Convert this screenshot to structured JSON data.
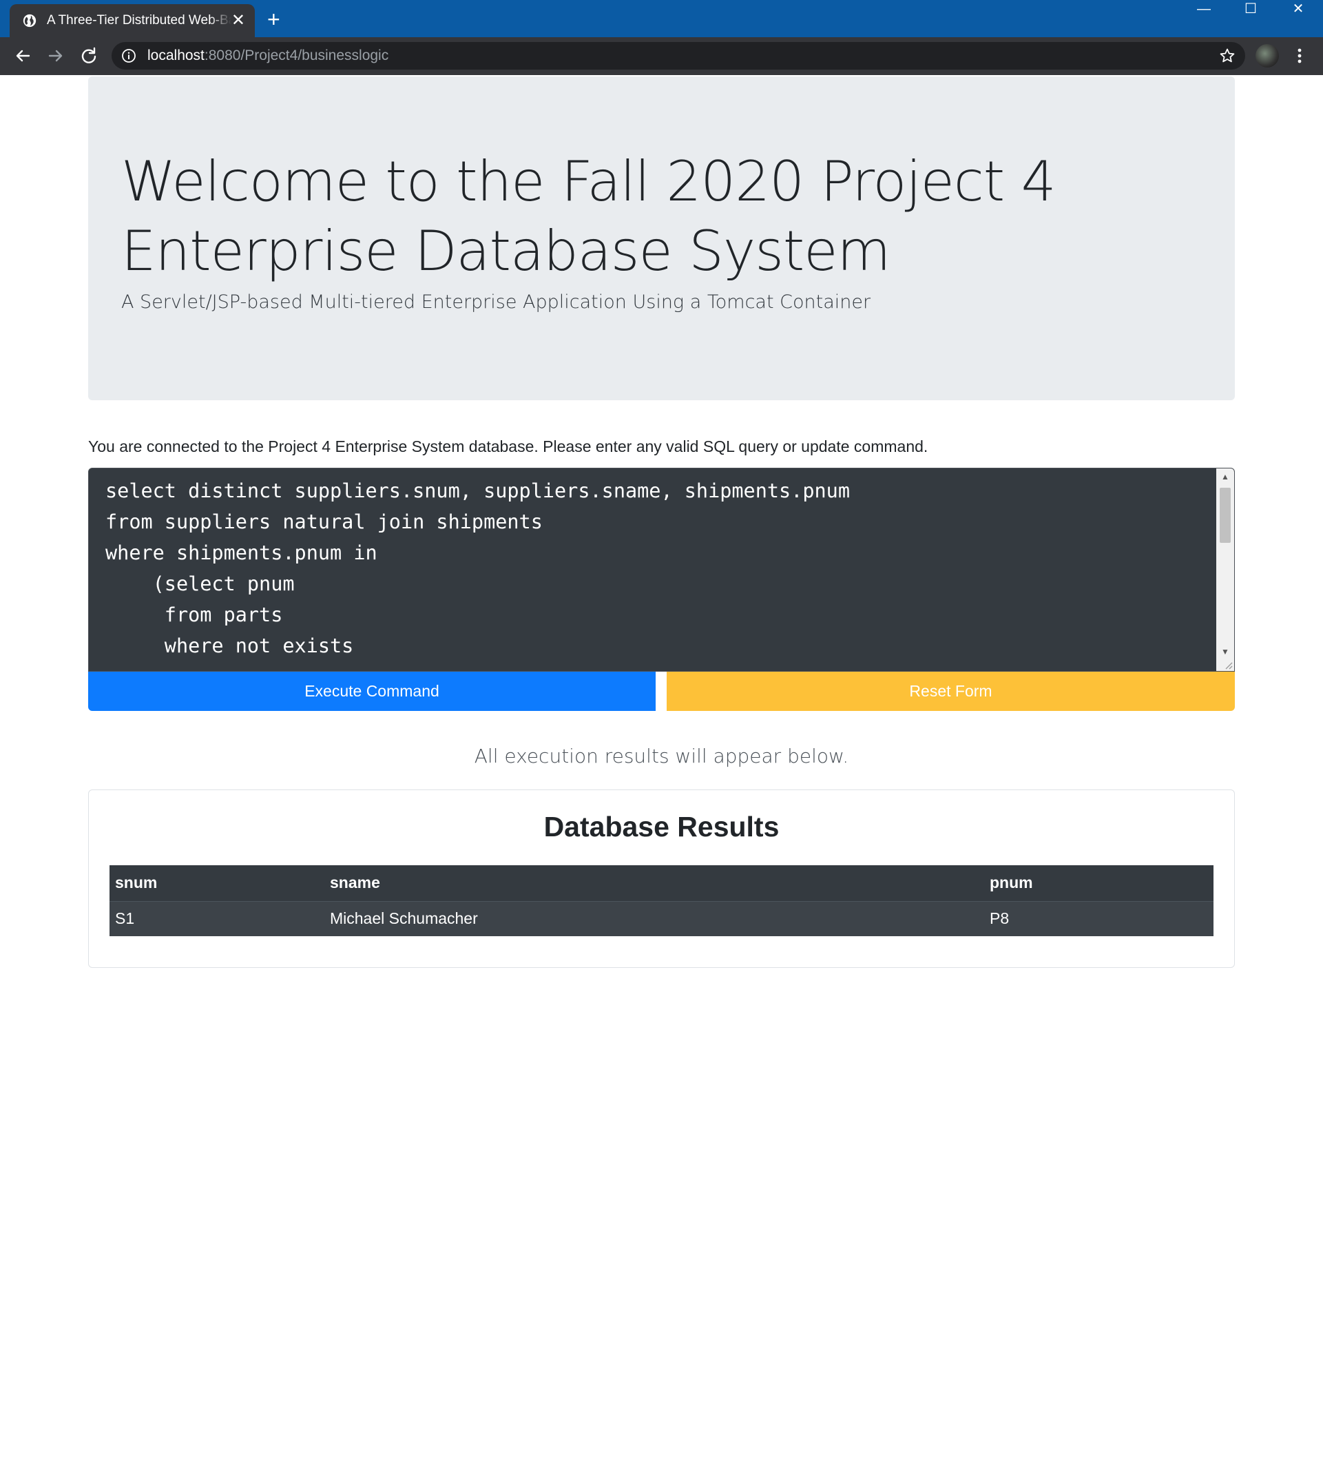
{
  "browser": {
    "tab_title": "A Three-Tier Distributed Web-Based Application",
    "new_tab_label": "+",
    "close_tab_label": "✕",
    "window_controls": {
      "minimize": "—",
      "maximize": "☐",
      "close": "✕"
    },
    "url_host": "localhost",
    "url_rest": ":8080/Project4/businesslogic"
  },
  "page": {
    "headline": "Welcome to the Fall 2020 Project 4 Enterprise Database System",
    "lead": "A Servlet/JSP-based Multi-tiered Enterprise Application Using a Tomcat Container",
    "prompt": "You are connected to the Project 4 Enterprise System database. Please enter any valid SQL query or update command.",
    "sql_command": "select distinct suppliers.snum, suppliers.sname, shipments.pnum\nfrom suppliers natural join shipments\nwhere shipments.pnum in\n    (select pnum\n     from parts\n     where not exists",
    "execute_button": "Execute Command",
    "reset_button": "Reset Form",
    "results_note": "All execution results will appear below.",
    "results": {
      "title": "Database Results",
      "columns": [
        "snum",
        "sname",
        "pnum"
      ],
      "rows": [
        [
          "S1",
          "Michael Schumacher",
          "P8"
        ]
      ]
    }
  },
  "colors": {
    "titlebar": "#0b5ba4",
    "toolbar": "#35363a",
    "jumbotron": "#e9ecef",
    "execute": "#0d7bfe",
    "reset": "#fdc138",
    "table": "#343a40"
  }
}
